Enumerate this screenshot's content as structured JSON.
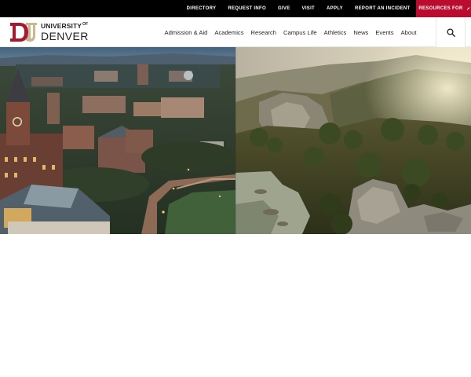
{
  "utility_bar": {
    "links": [
      {
        "label": "DIRECTORY"
      },
      {
        "label": "REQUEST INFO"
      },
      {
        "label": "GIVE"
      },
      {
        "label": "VISIT"
      },
      {
        "label": "APPLY"
      },
      {
        "label": "REPORT AN INCIDENT"
      }
    ],
    "resources_label": "RESOURCES FOR",
    "resources_icon": "chevron-right-icon",
    "background": "#000000",
    "accent": "#ba0c2f"
  },
  "header": {
    "logo": {
      "monogram": "DU",
      "line1": "UNIVERSITY",
      "line1_suffix": "OF",
      "line2": "DENVER",
      "brand_crimson": "#a6192e",
      "brand_gold": "#c9b78d"
    },
    "nav": [
      {
        "label": "Admission & Aid"
      },
      {
        "label": "Academics"
      },
      {
        "label": "Research"
      },
      {
        "label": "Campus Life"
      },
      {
        "label": "Athletics"
      },
      {
        "label": "News"
      },
      {
        "label": "Events"
      },
      {
        "label": "About"
      }
    ],
    "search_icon": "search-icon"
  },
  "hero": {
    "left_image": "campus-at-dusk-aerial",
    "right_image": "mountain-forest-sunset"
  }
}
